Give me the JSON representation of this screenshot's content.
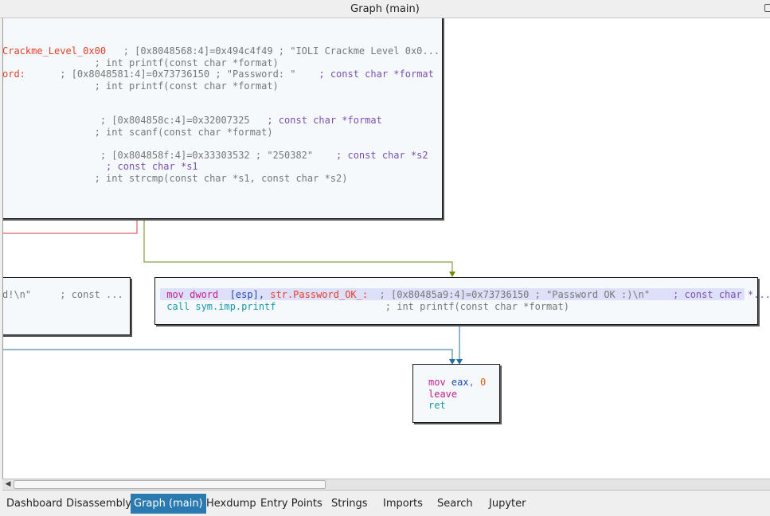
{
  "window": {
    "title": "Graph (main)"
  },
  "nodes": {
    "top": {
      "lines": [
        [
          {
            "t": "Crackme_Level_0x00",
            "c": "c-str"
          },
          {
            "t": "   ; [0x8048568:4]=0x494c4f49 ; \"IOLI Crackme Level 0x0...",
            "c": "c-cmt"
          }
        ],
        [
          {
            "t": "                ; int printf(const char *format)",
            "c": "c-cmt"
          }
        ],
        [
          {
            "t": "ord:",
            "c": "c-str"
          },
          {
            "t": "      ; [0x8048581:4]=0x73736150 ; \"Password: \"    ",
            "c": "c-cmt"
          },
          {
            "t": "; const char *format",
            "c": "c-purple"
          }
        ],
        [
          {
            "t": "                ; int printf(const char *format)",
            "c": "c-cmt"
          }
        ],
        [
          {
            "t": "",
            "c": "c-cmt"
          }
        ],
        [
          {
            "t": "",
            "c": "c-cmt"
          }
        ],
        [
          {
            "t": "                 ; [0x804858c:4]=0x32007325   ",
            "c": "c-cmt"
          },
          {
            "t": "; const char *format",
            "c": "c-purple"
          }
        ],
        [
          {
            "t": "                ; int scanf(const char *format)",
            "c": "c-cmt"
          }
        ],
        [
          {
            "t": "",
            "c": "c-cmt"
          }
        ],
        [
          {
            "t": "                 ; [0x804858f:4]=0x33303532 ; \"250382\"    ",
            "c": "c-cmt"
          },
          {
            "t": "; const char *s2",
            "c": "c-purple"
          }
        ],
        [
          {
            "t": "                  ; const char *s1",
            "c": "c-purple"
          }
        ],
        [
          {
            "t": "                ; int strcmp(const char *s1, const char *s2)",
            "c": "c-cmt"
          }
        ]
      ]
    },
    "left": {
      "lines": [
        [
          {
            "t": "d!\\n\"     ",
            "c": "c-cmt"
          },
          {
            "t": "; const ...",
            "c": "c-cmt"
          }
        ]
      ]
    },
    "ok": {
      "lines": [
        [
          {
            "t": " mov dword ",
            "c": "c-mn"
          },
          {
            "t": " [esp], ",
            "c": "c-reg"
          },
          {
            "t": "str.Password_OK_:",
            "c": "c-str"
          },
          {
            "t": "  ; [0x80485a9:4]=0x73736150 ; \"Password OK :)\\n\"    ",
            "c": "c-cmt"
          },
          {
            "t": "; const char *...",
            "c": "c-purple"
          }
        ],
        [
          {
            "t": " call sym.imp.printf",
            "c": "c-call"
          },
          {
            "t": "                   ; int printf(const char *format)",
            "c": "c-cmt"
          }
        ]
      ]
    },
    "end": {
      "lines": [
        [
          {
            "t": "mov ",
            "c": "c-mn"
          },
          {
            "t": "eax",
            "c": "c-reg"
          },
          {
            "t": ", ",
            "c": "c-cmt"
          },
          {
            "t": "0",
            "c": "c-num"
          }
        ],
        [
          {
            "t": "leave",
            "c": "c-mn"
          }
        ],
        [
          {
            "t": "ret",
            "c": "c-call"
          }
        ]
      ]
    }
  },
  "colors": {
    "edge_green": "#6a8a10",
    "edge_blue": "#1f6fa0",
    "edge_red": "#d04040"
  },
  "tabs": [
    {
      "label": "Dashboard",
      "active": false
    },
    {
      "label": "Disassembly",
      "active": false
    },
    {
      "label": "Graph (main)",
      "active": true
    },
    {
      "label": "Hexdump",
      "active": false
    },
    {
      "label": "Entry Points",
      "active": false
    },
    {
      "label": "Strings",
      "active": false
    },
    {
      "label": "Imports",
      "active": false
    },
    {
      "label": "Search",
      "active": false
    },
    {
      "label": "Jupyter",
      "active": false
    }
  ],
  "scrollbar": {
    "left_arrow_icon": "arrow-left-icon"
  }
}
